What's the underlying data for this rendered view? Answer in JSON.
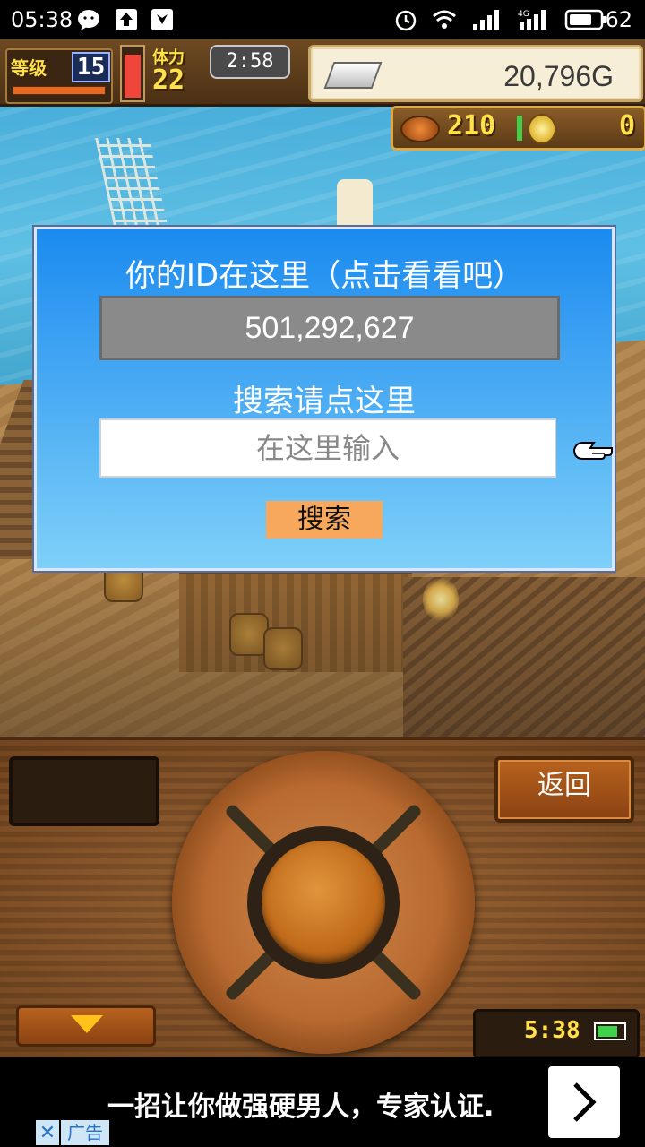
{
  "status_bar": {
    "time": "05:38",
    "battery_percent": "62",
    "network_label": "4G"
  },
  "hud": {
    "level_label": "等级",
    "level_value": "15",
    "stamina_label": "体力",
    "stamina_value": "22",
    "stamina_level": 0.9,
    "clock": "2:58",
    "gold": "20,796G",
    "resource_a": "210",
    "resource_b": "0"
  },
  "dialog": {
    "title": "你的ID在这里（点击看看吧）",
    "user_id": "501,292,627",
    "search_label": "搜索请点这里",
    "search_placeholder": "在这里输入",
    "search_button": "搜索"
  },
  "panel": {
    "back_button": "返回",
    "mini_time": "5:38",
    "mini_battery_level": 0.8
  },
  "ad": {
    "text": "一招让你做强硬男人，专家认证.",
    "tag": "广告",
    "close": "✕"
  },
  "colors": {
    "dialog_top": "#1b8bf0",
    "dialog_bottom": "#7ed0f8",
    "search_button_bg": "#f7a85c",
    "id_field_bg": "#8a8a8a"
  },
  "icons": [
    "wechat-icon",
    "upload-icon",
    "shield-icon",
    "alarm-icon",
    "wifi-icon",
    "signal-icon",
    "battery-icon",
    "silver-bar-icon",
    "meat-icon",
    "coin-icon",
    "pointing-hand-icon",
    "down-arrow-icon",
    "chevron-right-icon"
  ]
}
